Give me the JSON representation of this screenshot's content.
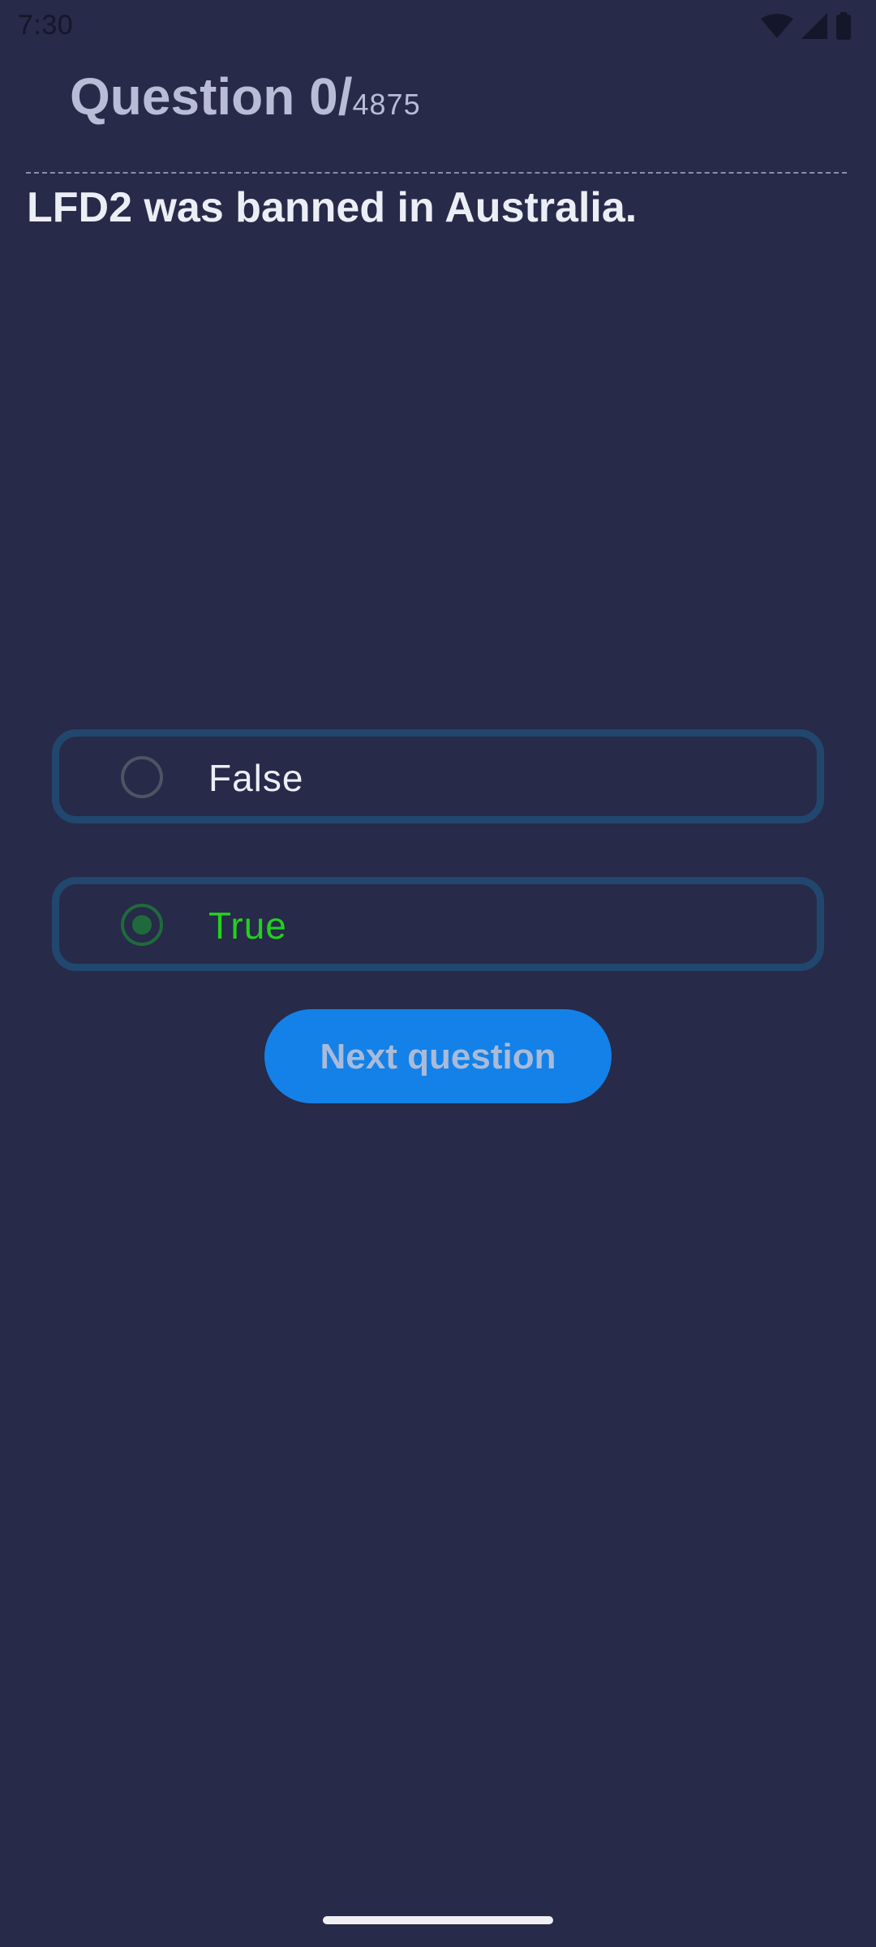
{
  "status_bar": {
    "time": "7:30",
    "icons": [
      "wifi-icon",
      "cellular-signal-icon",
      "battery-icon"
    ]
  },
  "header": {
    "question_prefix": "Question 0/",
    "question_total": "4875"
  },
  "question": {
    "text": "LFD2 was banned in Australia."
  },
  "options": [
    {
      "label": "False",
      "selected": false
    },
    {
      "label": "True",
      "selected": true
    }
  ],
  "next_button": {
    "label": "Next question"
  },
  "colors": {
    "background": "#272a48",
    "option_border": "#22476e",
    "selected_text": "#22d11f",
    "radio_selected": "#1f6a3c",
    "button": "#1381e8"
  }
}
